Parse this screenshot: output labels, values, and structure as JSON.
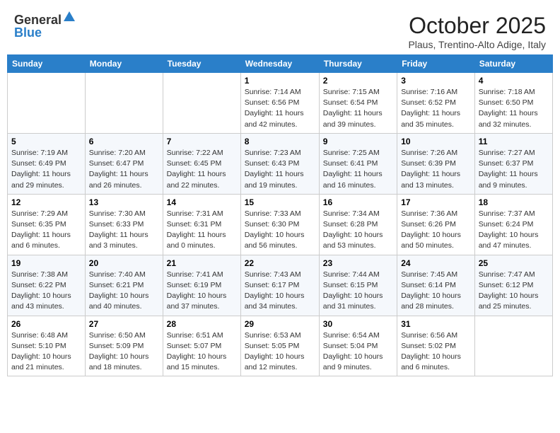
{
  "header": {
    "logo_general": "General",
    "logo_blue": "Blue",
    "title": "October 2025",
    "location": "Plaus, Trentino-Alto Adige, Italy"
  },
  "weekdays": [
    "Sunday",
    "Monday",
    "Tuesday",
    "Wednesday",
    "Thursday",
    "Friday",
    "Saturday"
  ],
  "weeks": [
    [
      {
        "day": "",
        "info": ""
      },
      {
        "day": "",
        "info": ""
      },
      {
        "day": "",
        "info": ""
      },
      {
        "day": "1",
        "info": "Sunrise: 7:14 AM\nSunset: 6:56 PM\nDaylight: 11 hours and 42 minutes."
      },
      {
        "day": "2",
        "info": "Sunrise: 7:15 AM\nSunset: 6:54 PM\nDaylight: 11 hours and 39 minutes."
      },
      {
        "day": "3",
        "info": "Sunrise: 7:16 AM\nSunset: 6:52 PM\nDaylight: 11 hours and 35 minutes."
      },
      {
        "day": "4",
        "info": "Sunrise: 7:18 AM\nSunset: 6:50 PM\nDaylight: 11 hours and 32 minutes."
      }
    ],
    [
      {
        "day": "5",
        "info": "Sunrise: 7:19 AM\nSunset: 6:49 PM\nDaylight: 11 hours and 29 minutes."
      },
      {
        "day": "6",
        "info": "Sunrise: 7:20 AM\nSunset: 6:47 PM\nDaylight: 11 hours and 26 minutes."
      },
      {
        "day": "7",
        "info": "Sunrise: 7:22 AM\nSunset: 6:45 PM\nDaylight: 11 hours and 22 minutes."
      },
      {
        "day": "8",
        "info": "Sunrise: 7:23 AM\nSunset: 6:43 PM\nDaylight: 11 hours and 19 minutes."
      },
      {
        "day": "9",
        "info": "Sunrise: 7:25 AM\nSunset: 6:41 PM\nDaylight: 11 hours and 16 minutes."
      },
      {
        "day": "10",
        "info": "Sunrise: 7:26 AM\nSunset: 6:39 PM\nDaylight: 11 hours and 13 minutes."
      },
      {
        "day": "11",
        "info": "Sunrise: 7:27 AM\nSunset: 6:37 PM\nDaylight: 11 hours and 9 minutes."
      }
    ],
    [
      {
        "day": "12",
        "info": "Sunrise: 7:29 AM\nSunset: 6:35 PM\nDaylight: 11 hours and 6 minutes."
      },
      {
        "day": "13",
        "info": "Sunrise: 7:30 AM\nSunset: 6:33 PM\nDaylight: 11 hours and 3 minutes."
      },
      {
        "day": "14",
        "info": "Sunrise: 7:31 AM\nSunset: 6:31 PM\nDaylight: 11 hours and 0 minutes."
      },
      {
        "day": "15",
        "info": "Sunrise: 7:33 AM\nSunset: 6:30 PM\nDaylight: 10 hours and 56 minutes."
      },
      {
        "day": "16",
        "info": "Sunrise: 7:34 AM\nSunset: 6:28 PM\nDaylight: 10 hours and 53 minutes."
      },
      {
        "day": "17",
        "info": "Sunrise: 7:36 AM\nSunset: 6:26 PM\nDaylight: 10 hours and 50 minutes."
      },
      {
        "day": "18",
        "info": "Sunrise: 7:37 AM\nSunset: 6:24 PM\nDaylight: 10 hours and 47 minutes."
      }
    ],
    [
      {
        "day": "19",
        "info": "Sunrise: 7:38 AM\nSunset: 6:22 PM\nDaylight: 10 hours and 43 minutes."
      },
      {
        "day": "20",
        "info": "Sunrise: 7:40 AM\nSunset: 6:21 PM\nDaylight: 10 hours and 40 minutes."
      },
      {
        "day": "21",
        "info": "Sunrise: 7:41 AM\nSunset: 6:19 PM\nDaylight: 10 hours and 37 minutes."
      },
      {
        "day": "22",
        "info": "Sunrise: 7:43 AM\nSunset: 6:17 PM\nDaylight: 10 hours and 34 minutes."
      },
      {
        "day": "23",
        "info": "Sunrise: 7:44 AM\nSunset: 6:15 PM\nDaylight: 10 hours and 31 minutes."
      },
      {
        "day": "24",
        "info": "Sunrise: 7:45 AM\nSunset: 6:14 PM\nDaylight: 10 hours and 28 minutes."
      },
      {
        "day": "25",
        "info": "Sunrise: 7:47 AM\nSunset: 6:12 PM\nDaylight: 10 hours and 25 minutes."
      }
    ],
    [
      {
        "day": "26",
        "info": "Sunrise: 6:48 AM\nSunset: 5:10 PM\nDaylight: 10 hours and 21 minutes."
      },
      {
        "day": "27",
        "info": "Sunrise: 6:50 AM\nSunset: 5:09 PM\nDaylight: 10 hours and 18 minutes."
      },
      {
        "day": "28",
        "info": "Sunrise: 6:51 AM\nSunset: 5:07 PM\nDaylight: 10 hours and 15 minutes."
      },
      {
        "day": "29",
        "info": "Sunrise: 6:53 AM\nSunset: 5:05 PM\nDaylight: 10 hours and 12 minutes."
      },
      {
        "day": "30",
        "info": "Sunrise: 6:54 AM\nSunset: 5:04 PM\nDaylight: 10 hours and 9 minutes."
      },
      {
        "day": "31",
        "info": "Sunrise: 6:56 AM\nSunset: 5:02 PM\nDaylight: 10 hours and 6 minutes."
      },
      {
        "day": "",
        "info": ""
      }
    ]
  ]
}
